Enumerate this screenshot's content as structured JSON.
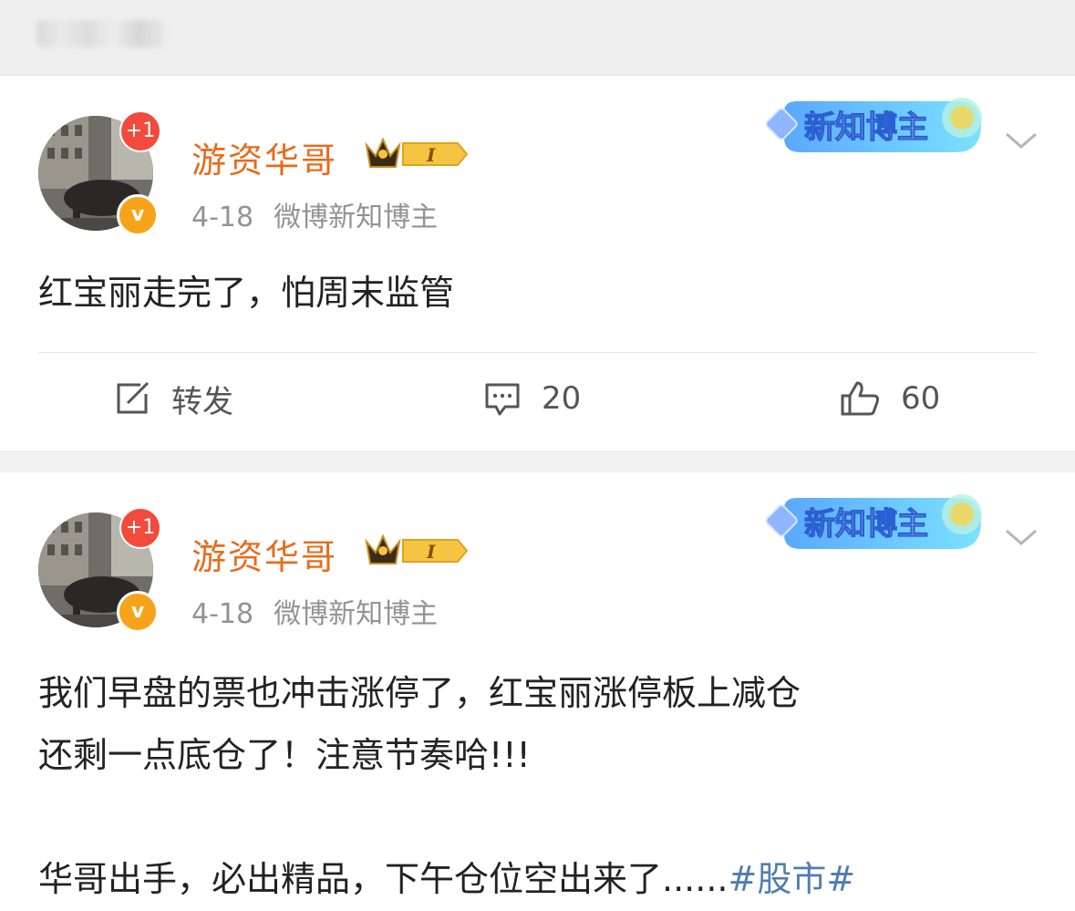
{
  "posts": [
    {
      "author": "游资华哥",
      "level": "I",
      "badge_plus": "+1",
      "verified": "v",
      "date": "4-18",
      "source": "微博新知博主",
      "tag_badge": "新知博主",
      "text_lines": [
        "红宝丽走完了，怕周末监管"
      ],
      "actions": {
        "repost_label": "转发",
        "comment_count": "20",
        "like_count": "60"
      }
    },
    {
      "author": "游资华哥",
      "level": "I",
      "badge_plus": "+1",
      "verified": "v",
      "date": "4-18",
      "source": "微博新知博主",
      "tag_badge": "新知博主",
      "text_lines": [
        "我们早盘的票也冲击涨停了，红宝丽涨停板上减仓",
        "还剩一点底仓了！注意节奏哈!!!",
        "",
        "华哥出手，必出精品，下午仓位空出来了......"
      ],
      "hashtag": "#股市#"
    }
  ],
  "colors": {
    "username": "#e86b1c",
    "hashtag": "#507daf",
    "meta": "#939393"
  },
  "icons": [
    "repost-icon",
    "comment-icon",
    "like-icon",
    "chevron-down-icon"
  ]
}
